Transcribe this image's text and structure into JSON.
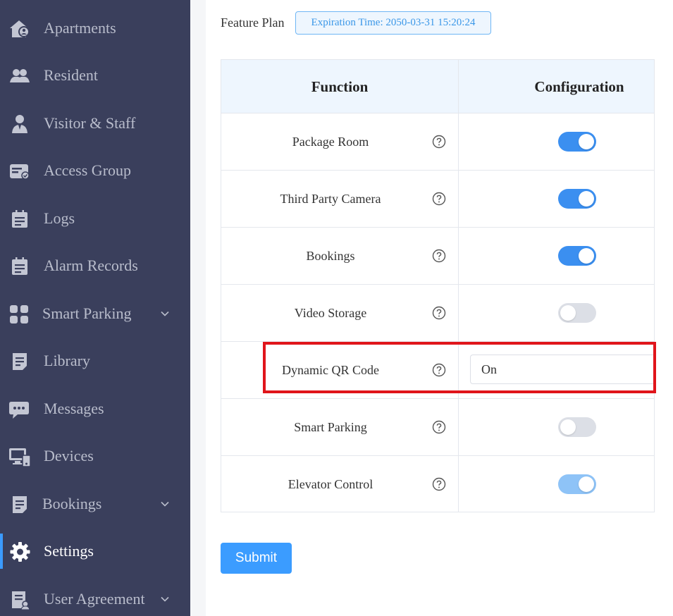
{
  "sidebar": {
    "items": [
      {
        "label": "Apartments",
        "icon": "apartment-icon"
      },
      {
        "label": "Resident",
        "icon": "residents-icon"
      },
      {
        "label": "Visitor & Staff",
        "icon": "visitor-icon"
      },
      {
        "label": "Access Group",
        "icon": "access-card-icon"
      },
      {
        "label": "Logs",
        "icon": "clipboard-icon"
      },
      {
        "label": "Alarm Records",
        "icon": "clipboard-icon"
      },
      {
        "label": "Smart Parking",
        "icon": "grid-icon",
        "expandable": true
      },
      {
        "label": "Library",
        "icon": "document-icon"
      },
      {
        "label": "Messages",
        "icon": "chat-icon"
      },
      {
        "label": "Devices",
        "icon": "devices-icon"
      },
      {
        "label": "Bookings",
        "icon": "document-icon",
        "expandable": true
      },
      {
        "label": "Settings",
        "icon": "gear-icon",
        "active": true
      },
      {
        "label": "User Agreement",
        "icon": "agreement-icon",
        "expandable": true
      }
    ]
  },
  "plan": {
    "label": "Feature Plan",
    "badge": "Expiration Time: 2050-03-31 15:20:24"
  },
  "table": {
    "headers": {
      "function": "Function",
      "configuration": "Configuration"
    },
    "rows": [
      {
        "function": "Package Room",
        "control": "switch",
        "state": "on"
      },
      {
        "function": "Third Party Camera",
        "control": "switch",
        "state": "on"
      },
      {
        "function": "Bookings",
        "control": "switch",
        "state": "on"
      },
      {
        "function": "Video Storage",
        "control": "switch",
        "state": "off"
      },
      {
        "function": "Dynamic QR Code",
        "control": "select",
        "value": "On"
      },
      {
        "function": "Smart Parking",
        "control": "switch",
        "state": "off"
      },
      {
        "function": "Elevator Control",
        "control": "switch",
        "state": "on-disabled"
      }
    ]
  },
  "actions": {
    "submit_label": "Submit"
  },
  "colors": {
    "sidebar_bg": "#3a3f5c",
    "accent": "#3b9cff",
    "switch_on": "#3b8ff0",
    "switch_off": "#dcdfe6",
    "highlight": "#e0151b"
  }
}
